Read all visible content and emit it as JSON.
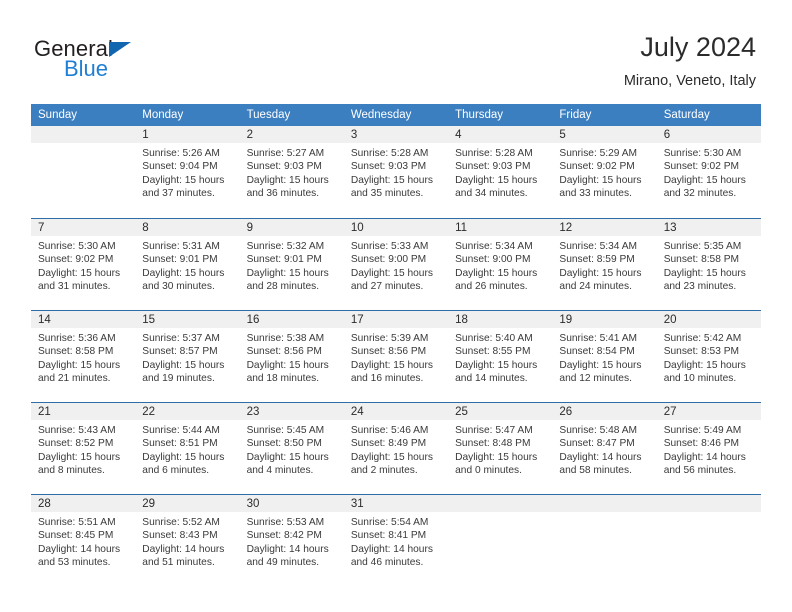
{
  "brand": {
    "name_top": "General",
    "name_bottom": "Blue",
    "triangle_icon": "triangle-icon",
    "color_top": "#231f20",
    "color_bottom": "#1f7fd4",
    "triangle_color": "#1266b0"
  },
  "header": {
    "title": "July 2024",
    "subtitle": "Mirano, Veneto, Italy"
  },
  "theme": {
    "header_bg": "#3c7fc1",
    "row_divider": "#2e6da8",
    "daynum_bg": "#f0f0f0",
    "text": "#2b2b2b"
  },
  "calendar": {
    "weekday_headers": [
      "Sunday",
      "Monday",
      "Tuesday",
      "Wednesday",
      "Thursday",
      "Friday",
      "Saturday"
    ],
    "weeks": [
      [
        {
          "day": "",
          "sunrise": "",
          "sunset": "",
          "daylight_l1": "",
          "daylight_l2": "",
          "empty": true
        },
        {
          "day": "1",
          "sunrise": "Sunrise: 5:26 AM",
          "sunset": "Sunset: 9:04 PM",
          "daylight_l1": "Daylight: 15 hours",
          "daylight_l2": "and 37 minutes."
        },
        {
          "day": "2",
          "sunrise": "Sunrise: 5:27 AM",
          "sunset": "Sunset: 9:03 PM",
          "daylight_l1": "Daylight: 15 hours",
          "daylight_l2": "and 36 minutes."
        },
        {
          "day": "3",
          "sunrise": "Sunrise: 5:28 AM",
          "sunset": "Sunset: 9:03 PM",
          "daylight_l1": "Daylight: 15 hours",
          "daylight_l2": "and 35 minutes."
        },
        {
          "day": "4",
          "sunrise": "Sunrise: 5:28 AM",
          "sunset": "Sunset: 9:03 PM",
          "daylight_l1": "Daylight: 15 hours",
          "daylight_l2": "and 34 minutes."
        },
        {
          "day": "5",
          "sunrise": "Sunrise: 5:29 AM",
          "sunset": "Sunset: 9:02 PM",
          "daylight_l1": "Daylight: 15 hours",
          "daylight_l2": "and 33 minutes."
        },
        {
          "day": "6",
          "sunrise": "Sunrise: 5:30 AM",
          "sunset": "Sunset: 9:02 PM",
          "daylight_l1": "Daylight: 15 hours",
          "daylight_l2": "and 32 minutes."
        }
      ],
      [
        {
          "day": "7",
          "sunrise": "Sunrise: 5:30 AM",
          "sunset": "Sunset: 9:02 PM",
          "daylight_l1": "Daylight: 15 hours",
          "daylight_l2": "and 31 minutes."
        },
        {
          "day": "8",
          "sunrise": "Sunrise: 5:31 AM",
          "sunset": "Sunset: 9:01 PM",
          "daylight_l1": "Daylight: 15 hours",
          "daylight_l2": "and 30 minutes."
        },
        {
          "day": "9",
          "sunrise": "Sunrise: 5:32 AM",
          "sunset": "Sunset: 9:01 PM",
          "daylight_l1": "Daylight: 15 hours",
          "daylight_l2": "and 28 minutes."
        },
        {
          "day": "10",
          "sunrise": "Sunrise: 5:33 AM",
          "sunset": "Sunset: 9:00 PM",
          "daylight_l1": "Daylight: 15 hours",
          "daylight_l2": "and 27 minutes."
        },
        {
          "day": "11",
          "sunrise": "Sunrise: 5:34 AM",
          "sunset": "Sunset: 9:00 PM",
          "daylight_l1": "Daylight: 15 hours",
          "daylight_l2": "and 26 minutes."
        },
        {
          "day": "12",
          "sunrise": "Sunrise: 5:34 AM",
          "sunset": "Sunset: 8:59 PM",
          "daylight_l1": "Daylight: 15 hours",
          "daylight_l2": "and 24 minutes."
        },
        {
          "day": "13",
          "sunrise": "Sunrise: 5:35 AM",
          "sunset": "Sunset: 8:58 PM",
          "daylight_l1": "Daylight: 15 hours",
          "daylight_l2": "and 23 minutes."
        }
      ],
      [
        {
          "day": "14",
          "sunrise": "Sunrise: 5:36 AM",
          "sunset": "Sunset: 8:58 PM",
          "daylight_l1": "Daylight: 15 hours",
          "daylight_l2": "and 21 minutes."
        },
        {
          "day": "15",
          "sunrise": "Sunrise: 5:37 AM",
          "sunset": "Sunset: 8:57 PM",
          "daylight_l1": "Daylight: 15 hours",
          "daylight_l2": "and 19 minutes."
        },
        {
          "day": "16",
          "sunrise": "Sunrise: 5:38 AM",
          "sunset": "Sunset: 8:56 PM",
          "daylight_l1": "Daylight: 15 hours",
          "daylight_l2": "and 18 minutes."
        },
        {
          "day": "17",
          "sunrise": "Sunrise: 5:39 AM",
          "sunset": "Sunset: 8:56 PM",
          "daylight_l1": "Daylight: 15 hours",
          "daylight_l2": "and 16 minutes."
        },
        {
          "day": "18",
          "sunrise": "Sunrise: 5:40 AM",
          "sunset": "Sunset: 8:55 PM",
          "daylight_l1": "Daylight: 15 hours",
          "daylight_l2": "and 14 minutes."
        },
        {
          "day": "19",
          "sunrise": "Sunrise: 5:41 AM",
          "sunset": "Sunset: 8:54 PM",
          "daylight_l1": "Daylight: 15 hours",
          "daylight_l2": "and 12 minutes."
        },
        {
          "day": "20",
          "sunrise": "Sunrise: 5:42 AM",
          "sunset": "Sunset: 8:53 PM",
          "daylight_l1": "Daylight: 15 hours",
          "daylight_l2": "and 10 minutes."
        }
      ],
      [
        {
          "day": "21",
          "sunrise": "Sunrise: 5:43 AM",
          "sunset": "Sunset: 8:52 PM",
          "daylight_l1": "Daylight: 15 hours",
          "daylight_l2": "and 8 minutes."
        },
        {
          "day": "22",
          "sunrise": "Sunrise: 5:44 AM",
          "sunset": "Sunset: 8:51 PM",
          "daylight_l1": "Daylight: 15 hours",
          "daylight_l2": "and 6 minutes."
        },
        {
          "day": "23",
          "sunrise": "Sunrise: 5:45 AM",
          "sunset": "Sunset: 8:50 PM",
          "daylight_l1": "Daylight: 15 hours",
          "daylight_l2": "and 4 minutes."
        },
        {
          "day": "24",
          "sunrise": "Sunrise: 5:46 AM",
          "sunset": "Sunset: 8:49 PM",
          "daylight_l1": "Daylight: 15 hours",
          "daylight_l2": "and 2 minutes."
        },
        {
          "day": "25",
          "sunrise": "Sunrise: 5:47 AM",
          "sunset": "Sunset: 8:48 PM",
          "daylight_l1": "Daylight: 15 hours",
          "daylight_l2": "and 0 minutes."
        },
        {
          "day": "26",
          "sunrise": "Sunrise: 5:48 AM",
          "sunset": "Sunset: 8:47 PM",
          "daylight_l1": "Daylight: 14 hours",
          "daylight_l2": "and 58 minutes."
        },
        {
          "day": "27",
          "sunrise": "Sunrise: 5:49 AM",
          "sunset": "Sunset: 8:46 PM",
          "daylight_l1": "Daylight: 14 hours",
          "daylight_l2": "and 56 minutes."
        }
      ],
      [
        {
          "day": "28",
          "sunrise": "Sunrise: 5:51 AM",
          "sunset": "Sunset: 8:45 PM",
          "daylight_l1": "Daylight: 14 hours",
          "daylight_l2": "and 53 minutes."
        },
        {
          "day": "29",
          "sunrise": "Sunrise: 5:52 AM",
          "sunset": "Sunset: 8:43 PM",
          "daylight_l1": "Daylight: 14 hours",
          "daylight_l2": "and 51 minutes."
        },
        {
          "day": "30",
          "sunrise": "Sunrise: 5:53 AM",
          "sunset": "Sunset: 8:42 PM",
          "daylight_l1": "Daylight: 14 hours",
          "daylight_l2": "and 49 minutes."
        },
        {
          "day": "31",
          "sunrise": "Sunrise: 5:54 AM",
          "sunset": "Sunset: 8:41 PM",
          "daylight_l1": "Daylight: 14 hours",
          "daylight_l2": "and 46 minutes."
        },
        {
          "day": "",
          "sunrise": "",
          "sunset": "",
          "daylight_l1": "",
          "daylight_l2": "",
          "empty": true
        },
        {
          "day": "",
          "sunrise": "",
          "sunset": "",
          "daylight_l1": "",
          "daylight_l2": "",
          "empty": true
        },
        {
          "day": "",
          "sunrise": "",
          "sunset": "",
          "daylight_l1": "",
          "daylight_l2": "",
          "empty": true
        }
      ]
    ]
  }
}
